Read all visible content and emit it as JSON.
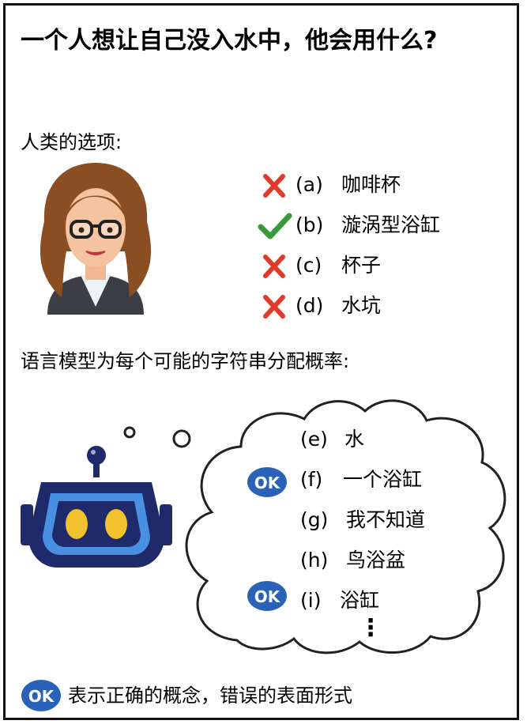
{
  "question": "一个人想让自己没入水中，他会用什么?",
  "human_heading": "人类的选项:",
  "human_options": [
    {
      "label": "(a)",
      "text": "咖啡杯",
      "mark": "cross"
    },
    {
      "label": "(b)",
      "text": "漩涡型浴缸",
      "mark": "check"
    },
    {
      "label": "(c)",
      "text": "杯子",
      "mark": "cross"
    },
    {
      "label": "(d)",
      "text": "水坑",
      "mark": "cross"
    }
  ],
  "model_heading": "语言模型为每个可能的字符串分配概率:",
  "model_options": [
    {
      "label": "(e)",
      "text": "水",
      "badge": false
    },
    {
      "label": "(f)",
      "text": "一个浴缸",
      "badge": true
    },
    {
      "label": "(g)",
      "text": "我不知道",
      "badge": false
    },
    {
      "label": "(h)",
      "text": "鸟浴盆",
      "badge": false
    },
    {
      "label": "(i)",
      "text": "浴缸",
      "badge": true
    }
  ],
  "ellipsis": "⋮",
  "badge_text": "OK",
  "footnote": "表示正确的概念，错误的表面形式",
  "colors": {
    "cross": "#e03a2a",
    "check": "#3a9a3a",
    "badge": "#2a62b8",
    "robot_head": "#1e2a6a",
    "robot_eye": "#f2c12e",
    "robot_screen": "#4a90e2"
  }
}
